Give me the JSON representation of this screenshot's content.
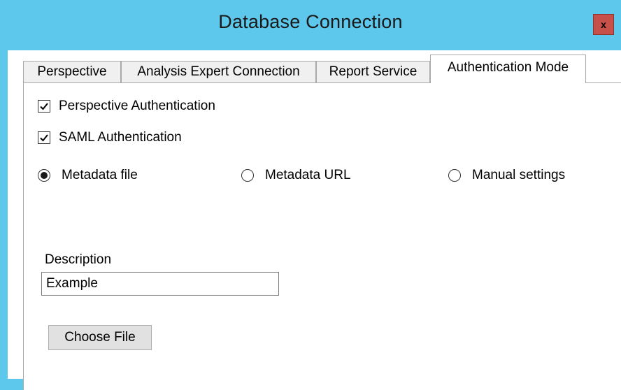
{
  "window": {
    "title": "Database Connection",
    "close_label": "x"
  },
  "tabs": [
    {
      "label": "Perspective",
      "active": false
    },
    {
      "label": "Analysis Expert Connection",
      "active": false
    },
    {
      "label": "Report Service",
      "active": false
    },
    {
      "label": "Authentication Mode",
      "active": true
    }
  ],
  "auth": {
    "perspective": {
      "label": "Perspective Authentication",
      "checked": true
    },
    "saml": {
      "label": "SAML Authentication",
      "checked": true
    }
  },
  "source_options": [
    {
      "label": "Metadata file",
      "selected": true
    },
    {
      "label": "Metadata URL",
      "selected": false
    },
    {
      "label": "Manual settings",
      "selected": false
    }
  ],
  "description": {
    "label": "Description",
    "value": "Example"
  },
  "choose_file_label": "Choose File",
  "colors": {
    "titlebar": "#5ec8ec",
    "close_button": "#c7514a"
  }
}
